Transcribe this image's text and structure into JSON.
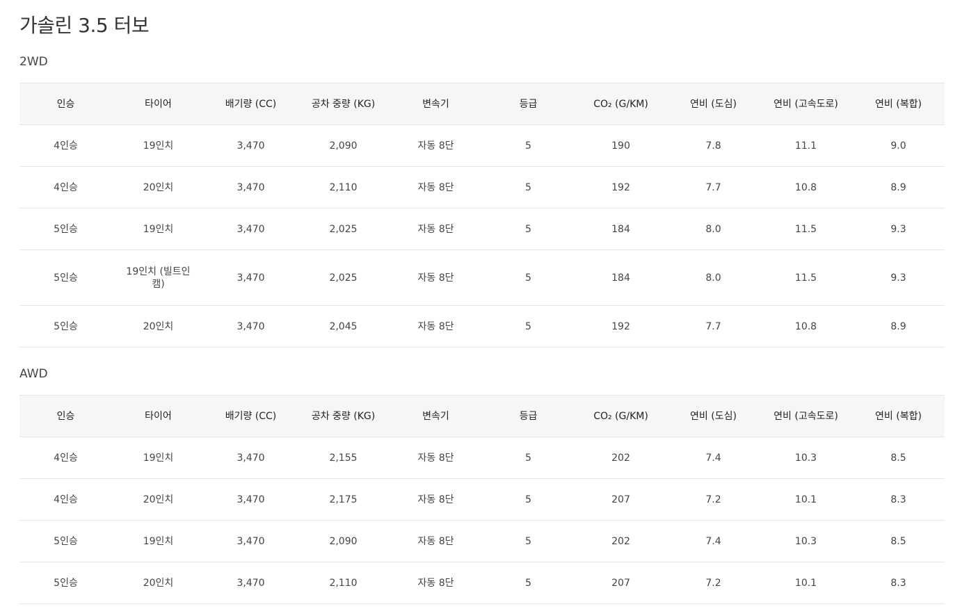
{
  "title": "가솔린 3.5 터보",
  "columns": [
    "인승",
    "타이어",
    "배기량 (CC)",
    "공차 중량 (KG)",
    "변속기",
    "등급",
    "CO₂ (G/KM)",
    "연비 (도심)",
    "연비 (고속도로)",
    "연비 (복합)"
  ],
  "sections": [
    {
      "label": "2WD",
      "rows": [
        [
          "4인승",
          "19인치",
          "3,470",
          "2,090",
          "자동 8단",
          "5",
          "190",
          "7.8",
          "11.1",
          "9.0"
        ],
        [
          "4인승",
          "20인치",
          "3,470",
          "2,110",
          "자동 8단",
          "5",
          "192",
          "7.7",
          "10.8",
          "8.9"
        ],
        [
          "5인승",
          "19인치",
          "3,470",
          "2,025",
          "자동 8단",
          "5",
          "184",
          "8.0",
          "11.5",
          "9.3"
        ],
        [
          "5인승",
          "19인치 (빌트인 캠)",
          "3,470",
          "2,025",
          "자동 8단",
          "5",
          "184",
          "8.0",
          "11.5",
          "9.3"
        ],
        [
          "5인승",
          "20인치",
          "3,470",
          "2,045",
          "자동 8단",
          "5",
          "192",
          "7.7",
          "10.8",
          "8.9"
        ]
      ]
    },
    {
      "label": "AWD",
      "rows": [
        [
          "4인승",
          "19인치",
          "3,470",
          "2,155",
          "자동 8단",
          "5",
          "202",
          "7.4",
          "10.3",
          "8.5"
        ],
        [
          "4인승",
          "20인치",
          "3,470",
          "2,175",
          "자동 8단",
          "5",
          "207",
          "7.2",
          "10.1",
          "8.3"
        ],
        [
          "5인승",
          "19인치",
          "3,470",
          "2,090",
          "자동 8단",
          "5",
          "202",
          "7.4",
          "10.3",
          "8.5"
        ],
        [
          "5인승",
          "20인치",
          "3,470",
          "2,110",
          "자동 8단",
          "5",
          "207",
          "7.2",
          "10.1",
          "8.3"
        ]
      ]
    }
  ]
}
